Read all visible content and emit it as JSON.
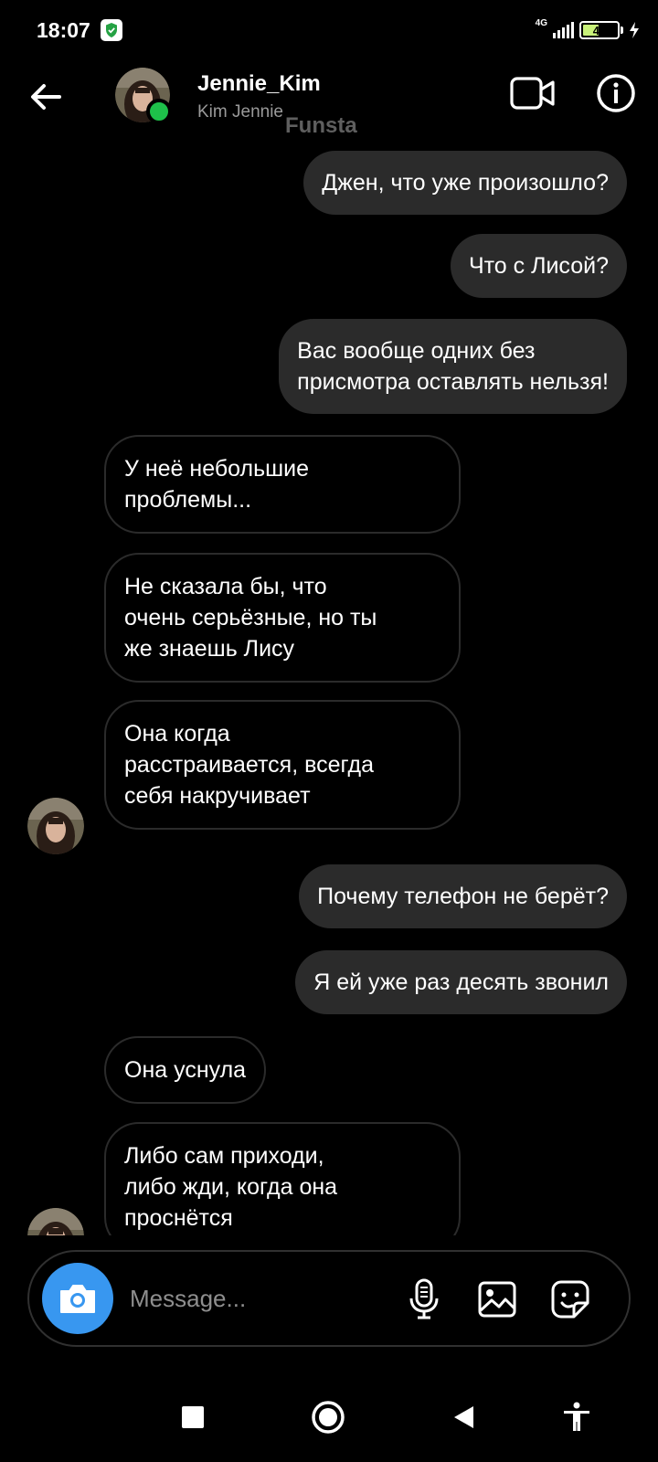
{
  "status_bar": {
    "time": "18:07",
    "network": "4G",
    "battery": "48",
    "battery_level": 0.48
  },
  "header": {
    "username": "Jennie_Kim",
    "display_name": "Kim Jennie",
    "watermark": "Funsta",
    "online_color": "#1ec14a"
  },
  "messages": [
    {
      "side": "out",
      "lines": [
        "Джен, что уже произошло?"
      ]
    },
    {
      "side": "out",
      "lines": [
        "Что с Лисой?"
      ]
    },
    {
      "side": "out",
      "lines": [
        "Вас вообще одних без",
        "присмотра оставлять нельзя!"
      ]
    },
    {
      "side": "in",
      "lines": [
        "У неё небольшие",
        "проблемы..."
      ]
    },
    {
      "side": "in",
      "lines": [
        "Не сказала бы, что",
        "очень серьёзные, но ты",
        "же знаешь Лису"
      ]
    },
    {
      "side": "in",
      "lines": [
        "Она когда",
        "расстраивается, всегда",
        "себя накручивает"
      ]
    },
    {
      "side": "out",
      "lines": [
        "Почему телефон не берёт?"
      ]
    },
    {
      "side": "out",
      "lines": [
        "Я ей уже раз десять звонил"
      ]
    },
    {
      "side": "in",
      "lines": [
        "Она уснула"
      ]
    },
    {
      "side": "in",
      "lines": [
        "Либо сам приходи,",
        "либо жди, когда она",
        "проснётся"
      ]
    }
  ],
  "composer": {
    "placeholder": "Message...",
    "camera_icon": "camera-icon",
    "mic_icon": "microphone-icon",
    "gallery_icon": "image-icon",
    "sticker_icon": "sticker-icon",
    "accent": "#3897f0"
  },
  "navbar": {
    "icons": [
      "recents-icon",
      "home-icon",
      "back-icon",
      "accessibility-icon"
    ]
  }
}
